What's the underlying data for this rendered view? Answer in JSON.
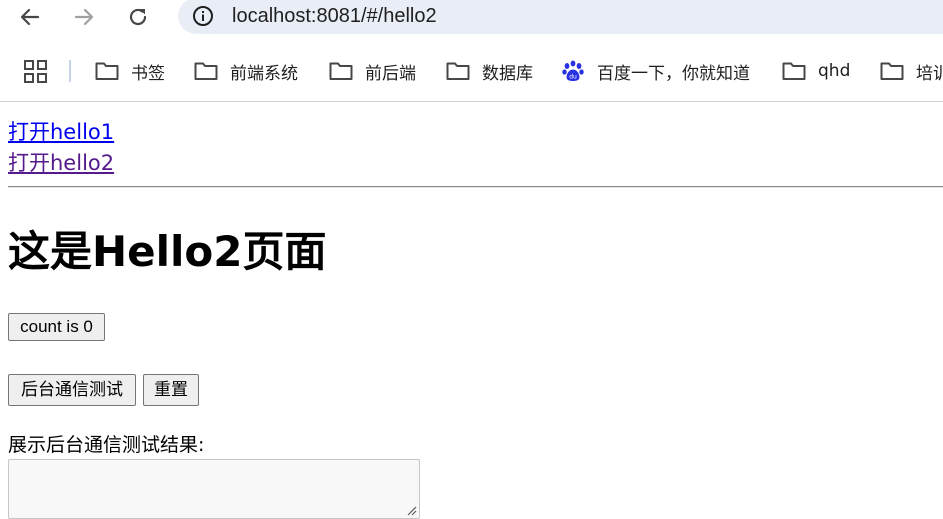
{
  "browser": {
    "url": "localhost:8081/#/hello2",
    "bookmarks": [
      {
        "label": "书签",
        "icon": "folder-icon"
      },
      {
        "label": "前端系统",
        "icon": "folder-icon"
      },
      {
        "label": "前后端",
        "icon": "folder-icon"
      },
      {
        "label": "数据库",
        "icon": "folder-icon"
      },
      {
        "label": "百度一下，你就知道",
        "icon": "baidu-paw-icon"
      },
      {
        "label": "qhd",
        "icon": "folder-icon"
      },
      {
        "label": "培训",
        "icon": "folder-icon"
      }
    ]
  },
  "page": {
    "links": [
      "打开hello1",
      "打开hello2"
    ],
    "title": "这是Hello2页面",
    "count_button": "count is 0",
    "test_button": "后台通信测试",
    "reset_button": "重置",
    "result_label": "展示后台通信测试结果:",
    "result_value": ""
  },
  "colors": {
    "link": "#0000ee",
    "visited_link": "#551a8b",
    "omnibox_bg": "#e9eef6",
    "baidu_blue": "#2932e1"
  }
}
